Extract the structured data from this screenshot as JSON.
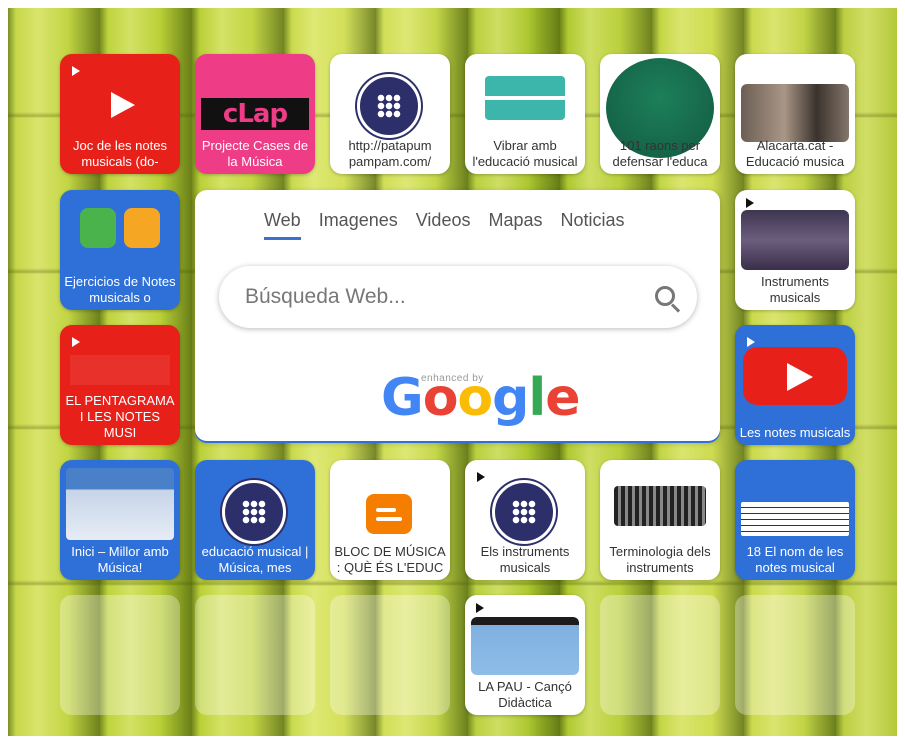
{
  "search": {
    "tabs": [
      "Web",
      "Imagenes",
      "Videos",
      "Mapas",
      "Noticias"
    ],
    "active_tab": "Web",
    "placeholder": "Búsqueda Web...",
    "enhanced_by": "enhanced by",
    "logo": "Google"
  },
  "tiles": [
    {
      "label": "Joc de les notes musicals (do-",
      "style": "red",
      "icon": "youtube-play-icon"
    },
    {
      "label": "Projecte Cases de la Música",
      "style": "pink",
      "icon": "clap-logo"
    },
    {
      "label": "http://patapum pampam.com/",
      "style": "white",
      "icon": "grid-icon"
    },
    {
      "label": "Vibrar amb l'educació musical",
      "style": "white",
      "icon": "interaccio-logo"
    },
    {
      "label": "101 raons per defensar l'educa",
      "style": "white",
      "icon": "mk-logo"
    },
    {
      "label": "Alacarta.cat - Educació musica",
      "style": "white",
      "icon": "video-thumbnail"
    },
    {
      "label": "Ejercicios de Notes musicals o",
      "style": "blue",
      "icon": "app-logo"
    },
    {
      "label": "Instruments musicals",
      "style": "white",
      "icon": "video-thumbnail"
    },
    {
      "label": "EL PENTAGRAMA I LES NOTES MUSI",
      "style": "red",
      "icon": "youtube-thumbnail"
    },
    {
      "label": "Les notes musicals",
      "style": "blue",
      "icon": "youtube-play-icon"
    },
    {
      "label": "Inici – Millor amb Música!",
      "style": "blue",
      "icon": "website-thumbnail"
    },
    {
      "label": "educació musical | Música, mes",
      "style": "blue",
      "icon": "grid-icon"
    },
    {
      "label": "BLOC DE MÚSICA : QUÈ ÉS L'EDUC",
      "style": "white",
      "icon": "blogger-icon"
    },
    {
      "label": "Els instruments musicals",
      "style": "white",
      "icon": "grid-icon"
    },
    {
      "label": "Terminologia dels instruments",
      "style": "white",
      "icon": "accordion-thumbnail"
    },
    {
      "label": "18 El nom de les notes musical",
      "style": "blue",
      "icon": "music-staff-thumbnail"
    },
    {
      "label": "LA PAU - Cançó Didàctica",
      "style": "white",
      "icon": "video-thumbnail"
    }
  ]
}
